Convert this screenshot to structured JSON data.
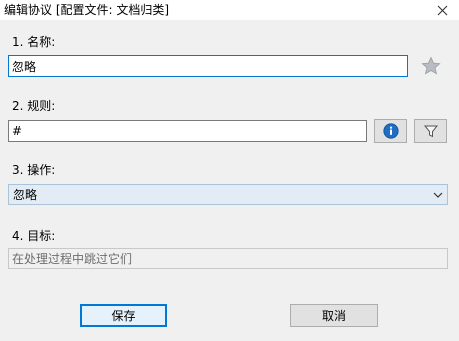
{
  "window": {
    "title": "编辑协议 [配置文件: 文档归类]"
  },
  "fields": {
    "name": {
      "label": "1. 名称:",
      "value": "忽略"
    },
    "rule": {
      "label": "2. 规则:",
      "value": "#"
    },
    "action": {
      "label": "3. 操作:",
      "value": "忽略"
    },
    "target": {
      "label": "4. 目标:",
      "value": "在处理过程中跳过它们"
    }
  },
  "icons": {
    "close": "close-icon",
    "favorite": "star-icon",
    "info": "info-icon",
    "filter": "filter-icon",
    "dropdown": "chevron-down-icon"
  },
  "buttons": {
    "save_label": "保存",
    "cancel_label": "取消"
  },
  "colors": {
    "accent": "#0078d7",
    "info_blue": "#1e6fc4"
  }
}
